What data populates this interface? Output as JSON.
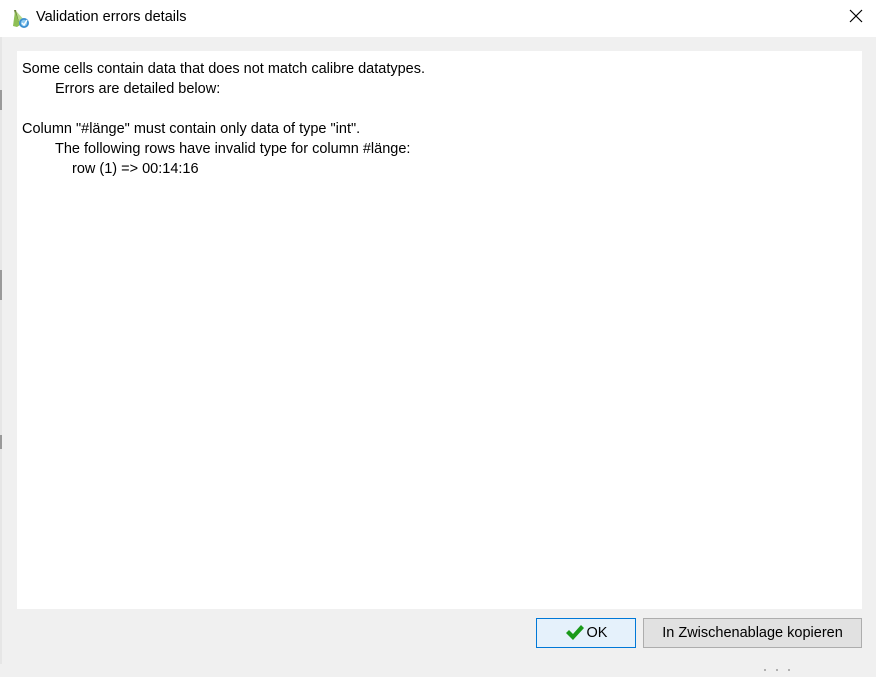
{
  "window": {
    "title": "Validation errors details"
  },
  "message": {
    "line1": "Some cells contain data that does not match calibre datatypes.",
    "line2": "Errors are detailed below:",
    "line3": "",
    "line4": "Column \"#länge\" must contain only data of type \"int\".",
    "line5": "The following rows have invalid type for column #länge:",
    "line6": "row (1) => 00:14:16"
  },
  "buttons": {
    "ok_label": "OK",
    "copy_label": "In Zwischenablage kopieren"
  },
  "icons": {
    "app": "calibre-app-icon",
    "close": "close-icon",
    "ok": "checkmark-icon"
  },
  "colors": {
    "ok_check": "#1a9a1a",
    "ok_border": "#0078d7"
  }
}
